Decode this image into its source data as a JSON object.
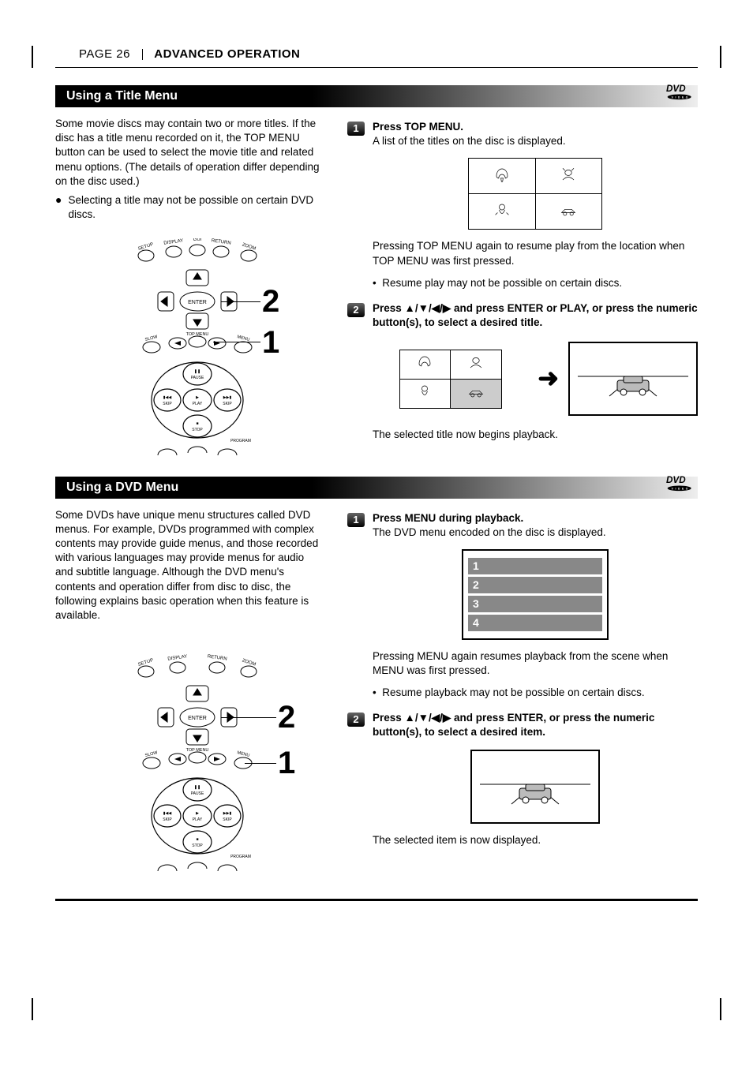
{
  "header": {
    "page_label": "PAGE 26",
    "section": "ADVANCED OPERATION"
  },
  "logo_alt": "DVD VIDEO",
  "title_menu": {
    "heading": "Using a Title Menu",
    "intro": "Some movie discs may contain two or more titles. If the disc has a title menu recorded on it, the TOP MENU button can be used to select the movie title and related menu options. (The details of operation differ depending on the disc used.)",
    "note": "Selecting a title may not be possible on certain DVD discs.",
    "remote_callout_1": "1",
    "remote_callout_2": "2",
    "step1": {
      "num": "1",
      "title": "Press TOP MENU.",
      "body": "A list of the titles on the disc is displayed.",
      "after1": "Pressing TOP MENU again to resume play from the location when TOP MENU was first pressed.",
      "after2": "Resume play may not be possible on certain discs."
    },
    "step2": {
      "num": "2",
      "title_pre": "Press ",
      "title_mid": " and press ENTER or PLAY, or press the numeric button(s), to select a desired title.",
      "after": "The selected title now begins playback."
    }
  },
  "dvd_menu": {
    "heading": "Using a DVD Menu",
    "intro": "Some DVDs have unique menu structures called DVD menus. For example, DVDs programmed with complex contents may provide guide menus, and those recorded with various languages may provide menus for audio and subtitle language. Although the DVD menu's contents and operation differ from disc to disc, the following explains basic operation when this feature is available.",
    "remote_callout_1": "1",
    "remote_callout_2": "2",
    "step1": {
      "num": "1",
      "title": "Press MENU during playback.",
      "body": "The DVD menu encoded on the disc is displayed.",
      "menu_items": [
        "1",
        "2",
        "3",
        "4"
      ],
      "after1": "Pressing MENU again resumes playback from the scene when MENU was first pressed.",
      "after2": "Resume playback may not be possible on certain discs."
    },
    "step2": {
      "num": "2",
      "title_pre": "Press ",
      "title_mid": " and press ENTER, or press the numeric button(s), to select a desired item.",
      "after": "The selected item is now displayed."
    }
  },
  "remote_labels": {
    "setup": "SETUP",
    "display": "DISPLAY",
    "gui": "GUI",
    "return": "RETURN",
    "zoom": "ZOOM",
    "enter": "ENTER",
    "slow": "SLOW",
    "top_menu": "TOP MENU",
    "menu": "MENU",
    "pause": "PAUSE",
    "skip_l": "SKIP",
    "play": "PLAY",
    "skip_r": "SKIP",
    "stop": "STOP",
    "program": "PROGRAM"
  }
}
